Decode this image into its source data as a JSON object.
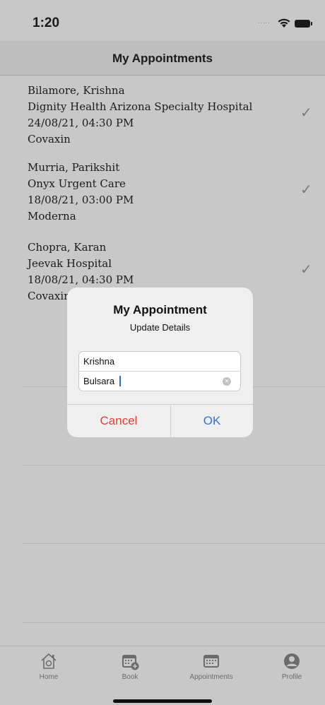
{
  "status": {
    "time": "1:20",
    "signal": "....."
  },
  "nav": {
    "title": "My Appointments"
  },
  "appointments": [
    {
      "name": "Bilamore, Krishna",
      "facility": "Dignity Health Arizona Specialty Hospital",
      "datetime": "24/08/21, 04:30 PM",
      "vaccine": "Covaxin",
      "check": "✓"
    },
    {
      "name": "Murria, Parikshit",
      "facility": "Onyx Urgent Care",
      "datetime": "18/08/21, 03:00 PM",
      "vaccine": "Moderna",
      "check": "✓"
    },
    {
      "name": "Chopra, Karan",
      "facility": "Jeevak Hospital",
      "datetime": "18/08/21, 04:30 PM",
      "vaccine": "Covaxin",
      "check": "✓"
    }
  ],
  "dialog": {
    "title": "My Appointment",
    "message": "Update Details",
    "field1_value": "Krishna",
    "field2_value": "Bulsara",
    "clear_glyph": "✕",
    "cancel_label": "Cancel",
    "ok_label": "OK",
    "cancel_color": "#e53b30",
    "ok_color": "#2f73e0"
  },
  "tabs": [
    {
      "label": "Home",
      "icon": "home-icon"
    },
    {
      "label": "Book",
      "icon": "calendar-add-icon"
    },
    {
      "label": "Appointments",
      "icon": "calendar-icon"
    },
    {
      "label": "Profile",
      "icon": "profile-icon"
    }
  ]
}
